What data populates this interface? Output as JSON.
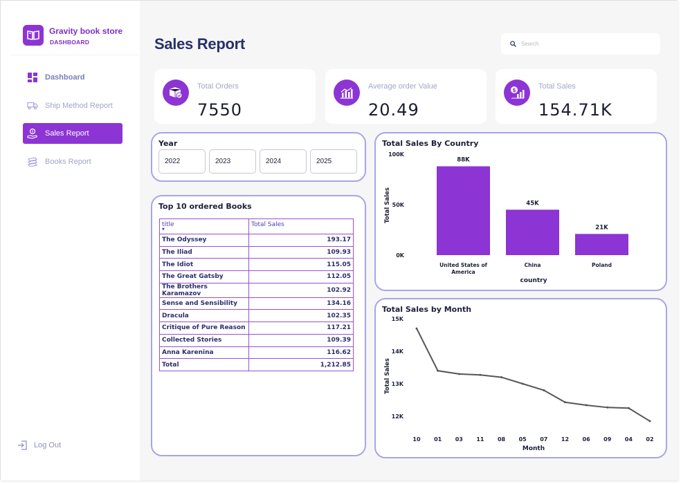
{
  "brand": {
    "title": "Gravity book store",
    "subtitle": "DASHBOARD"
  },
  "nav": {
    "dashboard": "Dashboard",
    "ship": "Ship Method Report",
    "sales": "Sales Report",
    "books": "Books Report",
    "logout": "Log Out"
  },
  "header": {
    "title": "Sales Report",
    "search_placeholder": "Search"
  },
  "kpis": {
    "orders": {
      "label": "Total Orders",
      "value": "7550"
    },
    "avg": {
      "label": "Average order Value",
      "value": "20.49"
    },
    "sales": {
      "label": "Total Sales",
      "value": "154.71K"
    }
  },
  "year_filter": {
    "title": "Year",
    "options": [
      "2022",
      "2023",
      "2024",
      "2025"
    ]
  },
  "books_table": {
    "title": "Top 10 ordered Books",
    "col_title": "title",
    "col_sales": "Total Sales",
    "rows": [
      [
        "The Odyssey",
        "193.17"
      ],
      [
        "The Iliad",
        "109.93"
      ],
      [
        "The Idiot",
        "115.05"
      ],
      [
        "The Great Gatsby",
        "112.05"
      ],
      [
        "The Brothers Karamazov",
        "102.92"
      ],
      [
        "Sense and Sensibility",
        "134.16"
      ],
      [
        "Dracula",
        "102.35"
      ],
      [
        "Critique of Pure Reason",
        "117.21"
      ],
      [
        "Collected Stories",
        "109.39"
      ],
      [
        "Anna Karenina",
        "116.62"
      ],
      [
        "Total",
        "1,212.85"
      ]
    ]
  },
  "colors": {
    "accent": "#8c34d4",
    "card_border": "#a8a4ea",
    "line": "#555555"
  },
  "chart_data": [
    {
      "type": "bar",
      "title": "Total Sales By Country",
      "categories": [
        "United States of America",
        "China",
        "Poland"
      ],
      "values": [
        88000,
        45000,
        21000
      ],
      "data_labels": [
        "88K",
        "45K",
        "21K"
      ],
      "xlabel": "country",
      "ylabel": "Total Sales",
      "yticks": [
        "100K",
        "50K",
        "0K"
      ],
      "ylim": [
        0,
        100000
      ],
      "grid": false
    },
    {
      "type": "line",
      "title": "Total Sales by Month",
      "x": [
        "10",
        "01",
        "03",
        "11",
        "08",
        "05",
        "07",
        "12",
        "06",
        "09",
        "04",
        "02"
      ],
      "values": [
        14700,
        13400,
        13300,
        13270,
        13200,
        13000,
        12800,
        12430,
        12340,
        12270,
        12250,
        11850
      ],
      "xlabel": "Month",
      "ylabel": "Total Sales",
      "yticks": [
        "15K",
        "14K",
        "13K",
        "12K"
      ],
      "ylim": [
        11500,
        15000
      ],
      "grid": false
    }
  ]
}
